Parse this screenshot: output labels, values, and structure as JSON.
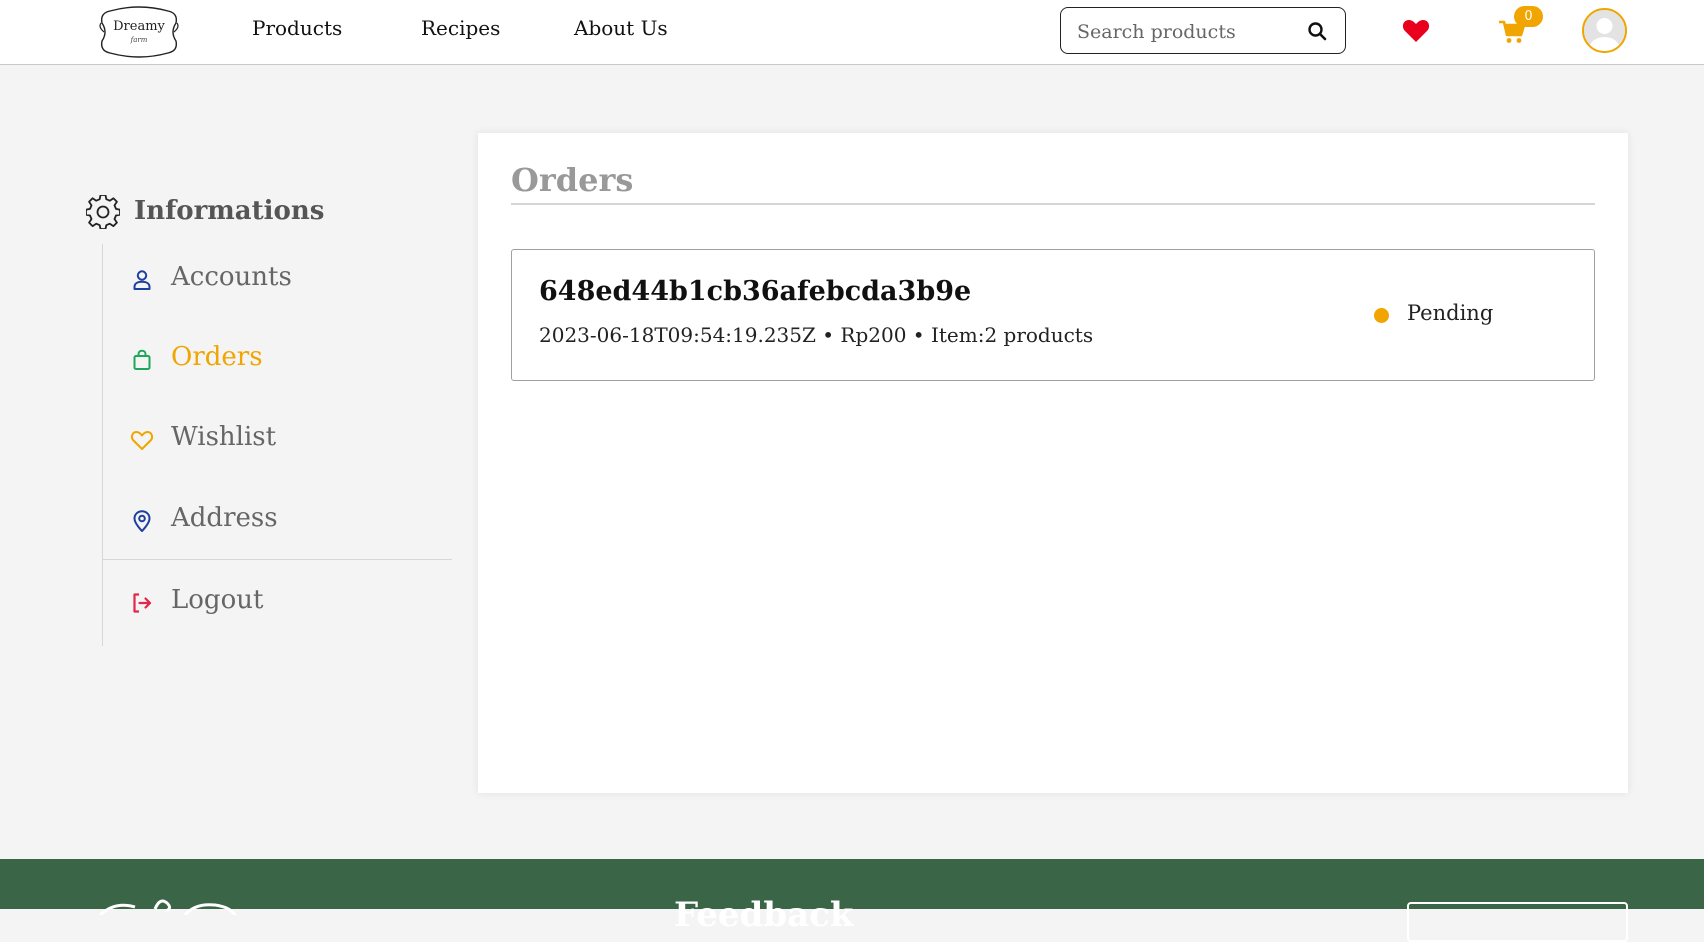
{
  "header": {
    "logo_text": "Dreamy",
    "logo_sub": "farm",
    "nav": [
      "Products",
      "Recipes",
      "About Us"
    ],
    "search_placeholder": "Search products",
    "cart_count": "0"
  },
  "sidebar": {
    "title": "Informations",
    "items": [
      {
        "label": "Accounts",
        "icon": "user-icon"
      },
      {
        "label": "Orders",
        "icon": "shopping-bag-icon"
      },
      {
        "label": "Wishlist",
        "icon": "heart-outline-icon"
      },
      {
        "label": "Address",
        "icon": "map-pin-icon"
      },
      {
        "label": "Logout",
        "icon": "logout-icon"
      }
    ],
    "active_index": 1
  },
  "main": {
    "title": "Orders",
    "orders": [
      {
        "id": "648ed44b1cb36afebcda3b9e",
        "meta": "2023-06-18T09:54:19.235Z • Rp200 • Item:2 products",
        "status": "Pending"
      }
    ]
  },
  "footer": {
    "heading": "Feedback"
  },
  "colors": {
    "accent": "#f0a500",
    "footer_bg": "#3a6647",
    "heart": "#e8001c",
    "user_icon": "#1d3f9e",
    "orders_icon": "#1ea65a",
    "logout_icon": "#e0284a"
  }
}
